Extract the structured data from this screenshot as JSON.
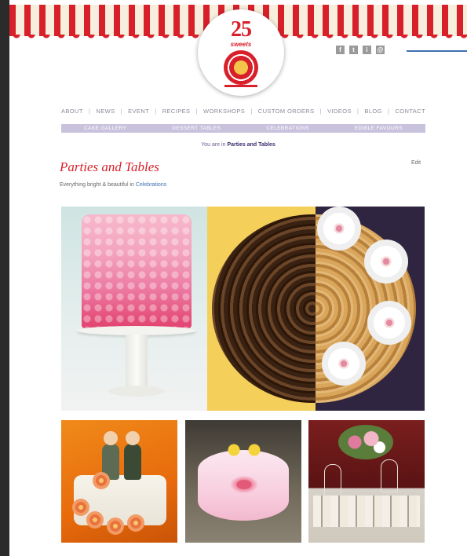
{
  "logo": {
    "number": "25",
    "word": "sweets"
  },
  "social": [
    {
      "icon": "facebook-icon",
      "glyph": "f"
    },
    {
      "icon": "twitter-icon",
      "glyph": "t"
    },
    {
      "icon": "instagram-icon",
      "glyph": "i"
    },
    {
      "icon": "email-icon",
      "glyph": "@"
    }
  ],
  "nav": {
    "items": [
      "ABOUT",
      "NEWS",
      "EVENT",
      "RECIPES",
      "WORKSHOPS",
      "CUSTOM ORDERS",
      "VIDEOS",
      "BLOG",
      "CONTACT"
    ]
  },
  "subnav": {
    "items": [
      "CAKE GALLERY",
      "DESSERT TABLES",
      "CELEBRATIONS",
      "EDIBLE FAVOURS"
    ]
  },
  "breadcrumb": {
    "prefix": "You are in",
    "current": "Parties and Tables"
  },
  "post": {
    "title": "Parties and Tables",
    "meta_prefix": "Everything bright & beautiful in",
    "meta_category": "Celebrations",
    "edit": "Edit"
  },
  "gallery": {
    "hero": [
      "pink ombre rose cake",
      "chocolate swirl cake",
      "white flower tart"
    ],
    "thumbs": [
      "wedding figurine cake",
      "pink bow cake",
      "dessert table"
    ]
  }
}
